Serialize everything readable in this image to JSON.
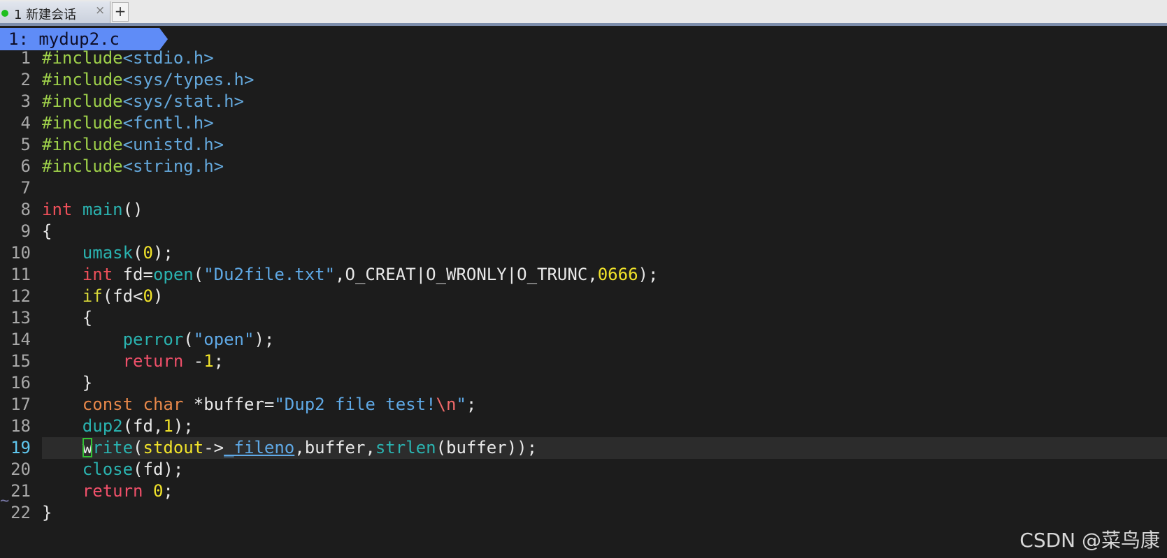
{
  "session_tabs": {
    "active": {
      "label": "1 新建会话",
      "close_glyph": "×",
      "status": "connected"
    },
    "add_label": "+"
  },
  "vim": {
    "tab_label": "1: mydup2.c",
    "current_line": 19,
    "empty_line_marker": "~",
    "lines": [
      {
        "n": "1",
        "tokens": [
          [
            "pp",
            "#include"
          ],
          [
            "hdr",
            "<stdio.h>"
          ]
        ]
      },
      {
        "n": "2",
        "tokens": [
          [
            "pp",
            "#include"
          ],
          [
            "hdr",
            "<sys/types.h>"
          ]
        ]
      },
      {
        "n": "3",
        "tokens": [
          [
            "pp",
            "#include"
          ],
          [
            "hdr",
            "<sys/stat.h>"
          ]
        ]
      },
      {
        "n": "4",
        "tokens": [
          [
            "pp",
            "#include"
          ],
          [
            "hdr",
            "<fcntl.h>"
          ]
        ]
      },
      {
        "n": "5",
        "tokens": [
          [
            "pp",
            "#include"
          ],
          [
            "hdr",
            "<unistd.h>"
          ]
        ]
      },
      {
        "n": "6",
        "tokens": [
          [
            "pp",
            "#include"
          ],
          [
            "hdr",
            "<string.h>"
          ]
        ]
      },
      {
        "n": "7",
        "tokens": []
      },
      {
        "n": "8",
        "tokens": [
          [
            "type",
            "int"
          ],
          [
            "def",
            " "
          ],
          [
            "fn",
            "main"
          ],
          [
            "def",
            "()"
          ]
        ]
      },
      {
        "n": "9",
        "tokens": [
          [
            "def",
            "{"
          ]
        ]
      },
      {
        "n": "10",
        "tokens": [
          [
            "def",
            "    "
          ],
          [
            "fn",
            "umask"
          ],
          [
            "def",
            "("
          ],
          [
            "num",
            "0"
          ],
          [
            "def",
            ");"
          ]
        ]
      },
      {
        "n": "11",
        "tokens": [
          [
            "def",
            "    "
          ],
          [
            "type",
            "int"
          ],
          [
            "def",
            " fd="
          ],
          [
            "fn",
            "open"
          ],
          [
            "def",
            "("
          ],
          [
            "str",
            "\"Du2file.txt\""
          ],
          [
            "def",
            ",O_CREAT|O_WRONLY|O_TRUNC,"
          ],
          [
            "num",
            "0666"
          ],
          [
            "def",
            ");"
          ]
        ]
      },
      {
        "n": "12",
        "tokens": [
          [
            "def",
            "    "
          ],
          [
            "ctl",
            "if"
          ],
          [
            "def",
            "(fd<"
          ],
          [
            "num",
            "0"
          ],
          [
            "def",
            ")"
          ]
        ]
      },
      {
        "n": "13",
        "tokens": [
          [
            "def",
            "    {"
          ]
        ]
      },
      {
        "n": "14",
        "tokens": [
          [
            "def",
            "        "
          ],
          [
            "fn",
            "perror"
          ],
          [
            "def",
            "("
          ],
          [
            "str",
            "\"open\""
          ],
          [
            "def",
            ");"
          ]
        ]
      },
      {
        "n": "15",
        "tokens": [
          [
            "def",
            "        "
          ],
          [
            "ret",
            "return"
          ],
          [
            "def",
            " -"
          ],
          [
            "num",
            "1"
          ],
          [
            "def",
            ";"
          ]
        ]
      },
      {
        "n": "16",
        "tokens": [
          [
            "def",
            "    }"
          ]
        ]
      },
      {
        "n": "17",
        "tokens": [
          [
            "def",
            "    "
          ],
          [
            "cst",
            "const"
          ],
          [
            "def",
            " "
          ],
          [
            "cst",
            "char"
          ],
          [
            "def",
            " *buffer="
          ],
          [
            "str",
            "\"Dup2 file test!"
          ],
          [
            "esc",
            "\\n"
          ],
          [
            "str",
            "\""
          ],
          [
            "def",
            ";"
          ]
        ]
      },
      {
        "n": "18",
        "tokens": [
          [
            "def",
            "    "
          ],
          [
            "fn",
            "dup2"
          ],
          [
            "def",
            "(fd,"
          ],
          [
            "num",
            "1"
          ],
          [
            "def",
            ");"
          ]
        ]
      },
      {
        "n": "19",
        "tokens": [
          [
            "def",
            "    "
          ],
          [
            "cur",
            "w"
          ],
          [
            "fn",
            "rite"
          ],
          [
            "def",
            "("
          ],
          [
            "std",
            "stdout"
          ],
          [
            "def",
            "->"
          ],
          [
            "fld",
            "_fileno"
          ],
          [
            "def",
            ",buffer,"
          ],
          [
            "fn",
            "strlen"
          ],
          [
            "def",
            "(buffer));"
          ]
        ]
      },
      {
        "n": "20",
        "tokens": [
          [
            "def",
            "    "
          ],
          [
            "fn",
            "close"
          ],
          [
            "def",
            "(fd);"
          ]
        ]
      },
      {
        "n": "21",
        "tokens": [
          [
            "def",
            "    "
          ],
          [
            "ret",
            "return"
          ],
          [
            "def",
            " "
          ],
          [
            "num",
            "0"
          ],
          [
            "def",
            ";"
          ]
        ]
      },
      {
        "n": "22",
        "tokens": [
          [
            "def",
            "}"
          ]
        ]
      }
    ]
  },
  "watermark": "CSDN @菜鸟康",
  "colors": {
    "background": "#1c1c1c",
    "tab_accent": "#5f8cf7",
    "status_dot": "#1fbf1f",
    "cursor": "#35c235"
  }
}
